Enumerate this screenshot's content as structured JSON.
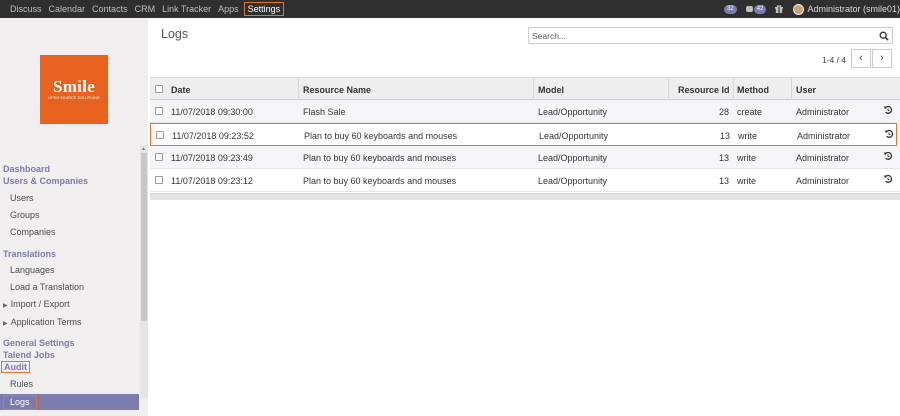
{
  "topbar": {
    "nav": [
      "Discuss",
      "Calendar",
      "Contacts",
      "CRM",
      "Link Tracker",
      "Apps"
    ],
    "active": "Settings",
    "badges": [
      "32",
      "42"
    ],
    "user": "Administrator (smile01)"
  },
  "sidebar": {
    "logo_title": "Smile",
    "logo_subtitle": "OPEN SOURCE SOLUTIONS",
    "dashboard": "Dashboard",
    "users_companies": "Users & Companies",
    "users": "Users",
    "groups": "Groups",
    "companies": "Companies",
    "translations": "Translations",
    "languages": "Languages",
    "load_translation": "Load a Translation",
    "import_export": "Import / Export",
    "application_terms": "Application Terms",
    "general_settings": "General Settings",
    "talend_jobs": "Talend Jobs",
    "audit": "Audit",
    "rules": "Rules",
    "logs": "Logs"
  },
  "main": {
    "title": "Logs",
    "search_placeholder": "Search...",
    "pager": "1-4 / 4",
    "columns": [
      "Date",
      "Resource Name",
      "Model",
      "Resource Id",
      "Method",
      "User"
    ],
    "rows": [
      {
        "date": "11/07/2018 09:30:00",
        "name": "Flash Sale",
        "model": "Lead/Opportunity",
        "rid": "28",
        "method": "create",
        "user": "Administrator"
      },
      {
        "date": "11/07/2018 09:23:52",
        "name": "Plan to buy 60 keyboards and mouses",
        "model": "Lead/Opportunity",
        "rid": "13",
        "method": "write",
        "user": "Administrator"
      },
      {
        "date": "11/07/2018 09:23:49",
        "name": "Plan to buy 60 keyboards and mouses",
        "model": "Lead/Opportunity",
        "rid": "13",
        "method": "write",
        "user": "Administrator"
      },
      {
        "date": "11/07/2018 09:23:12",
        "name": "Plan to buy 60 keyboards and mouses",
        "model": "Lead/Opportunity",
        "rid": "13",
        "method": "write",
        "user": "Administrator"
      }
    ]
  },
  "colors": {
    "accent": "#7c7bad",
    "highlight": "#e8742b",
    "brand": "#e8621f",
    "topbar": "#2f2f2f"
  }
}
